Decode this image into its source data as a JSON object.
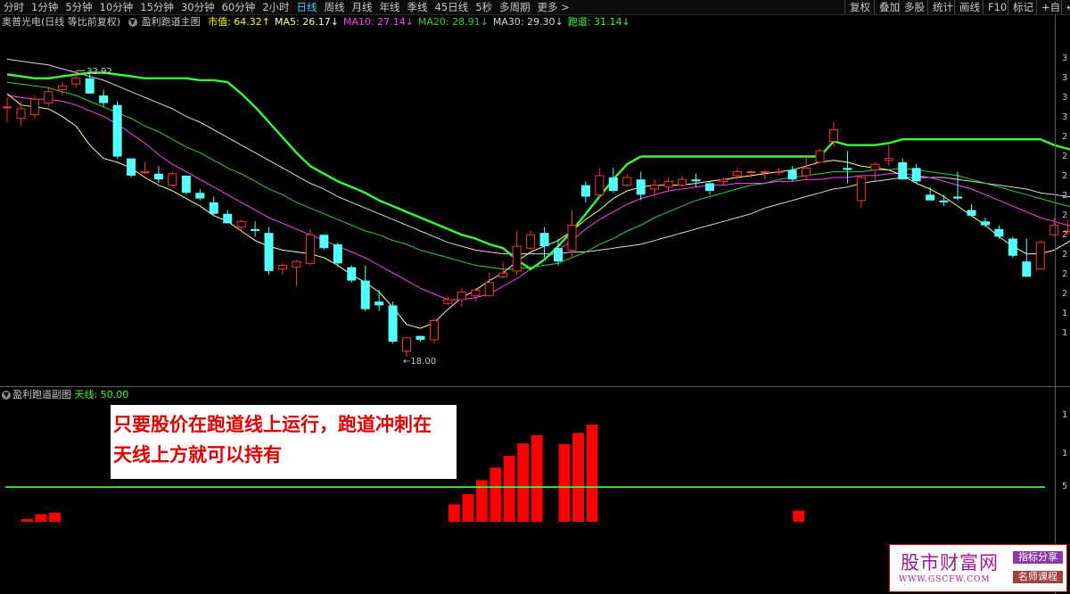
{
  "periods": [
    "分时",
    "1分钟",
    "5分钟",
    "10分钟",
    "15分钟",
    "30分钟",
    "60分钟",
    "2小时",
    "日线",
    "周线",
    "月线",
    "年线",
    "季线",
    "45日线",
    "5秒",
    "多周期",
    "更多 >"
  ],
  "active_period": "日线",
  "toolbar": [
    "复权",
    "叠加",
    "多股",
    "统计",
    "画线",
    "F10",
    "标记",
    "+自选",
    "↩"
  ],
  "main_legend": {
    "stock": "奥普光电(日线 等比前复权)",
    "indicator": "盈利跑道主图",
    "items": [
      {
        "label": "市值: 64.32↑",
        "color": "#ffff00"
      },
      {
        "label": "MA5: 26.17↓",
        "color": "#ffff9a"
      },
      {
        "label": "MA10: 27.14↓",
        "color": "#ff40ff"
      },
      {
        "label": "MA20: 28.91↓",
        "color": "#2ed22e"
      },
      {
        "label": "MA30: 29.30↓",
        "color": "#d8d8d8"
      },
      {
        "label": "跑道: 31.14↓",
        "color": "#33ff33"
      }
    ]
  },
  "sub_legend": {
    "indicator": "盈利跑道副图",
    "value": "天线: 50.00",
    "value_color": "#33ff33"
  },
  "price_labels": {
    "high": "32.92",
    "low": "18.00"
  },
  "y_ticks_main": [
    "3",
    "3",
    "3",
    "3",
    "2",
    "2",
    "2",
    "2",
    "2",
    "2",
    "2",
    "2",
    "2",
    "1",
    "1"
  ],
  "y_ticks_sub": [
    "1",
    "1",
    "5"
  ],
  "annotation": {
    "line1": "只要股价在跑道线上运行，跑道冲刺在",
    "line2": "天线上方就可以持有"
  },
  "watermark": {
    "main": "股市财富网",
    "url": "WWW.GSCFW.COM",
    "tag1": "指标分享",
    "tag2": "名师课程"
  },
  "colors": {
    "up": "#ff3232",
    "down": "#54ffff",
    "runway": "#33ff33",
    "ma5": "#ffff9a",
    "ma10": "#ff40ff",
    "ma20": "#2ed22e",
    "ma30": "#d8d8d8",
    "sub_bar": "#ff0000",
    "antenna": "#33ff33"
  },
  "chart_data": {
    "type": "candlestick",
    "candles": [
      [
        31.0,
        31.5,
        30.2,
        31.0
      ],
      [
        30.4,
        31.3,
        30.0,
        30.9
      ],
      [
        30.6,
        31.6,
        30.4,
        31.4
      ],
      [
        31.2,
        32.0,
        31.0,
        31.8
      ],
      [
        31.9,
        32.3,
        31.6,
        32.1
      ],
      [
        32.2,
        32.9,
        32.0,
        32.5
      ],
      [
        32.5,
        32.8,
        31.7,
        31.7
      ],
      [
        31.6,
        31.9,
        31.0,
        31.2
      ],
      [
        31.1,
        31.3,
        28.3,
        28.4
      ],
      [
        28.3,
        28.3,
        27.3,
        27.4
      ],
      [
        27.6,
        28.1,
        27.5,
        27.6
      ],
      [
        27.5,
        27.9,
        27.0,
        27.2
      ],
      [
        26.9,
        27.6,
        26.8,
        27.5
      ],
      [
        27.4,
        27.4,
        26.4,
        26.5
      ],
      [
        26.5,
        26.7,
        26.1,
        26.2
      ],
      [
        26.0,
        26.3,
        25.3,
        25.4
      ],
      [
        25.4,
        25.6,
        24.9,
        24.9
      ],
      [
        24.7,
        25.1,
        24.5,
        25.0
      ],
      [
        24.6,
        25.0,
        24.2,
        24.5
      ],
      [
        24.4,
        24.7,
        22.2,
        22.4
      ],
      [
        22.5,
        22.8,
        22.2,
        22.7
      ],
      [
        22.6,
        23.0,
        21.6,
        22.9
      ],
      [
        22.8,
        24.6,
        22.7,
        24.3
      ],
      [
        24.3,
        24.3,
        23.5,
        23.6
      ],
      [
        23.8,
        23.9,
        22.6,
        22.8
      ],
      [
        22.6,
        22.7,
        21.8,
        21.9
      ],
      [
        21.9,
        22.7,
        20.3,
        20.4
      ],
      [
        20.8,
        21.4,
        20.3,
        20.6
      ],
      [
        20.6,
        20.8,
        18.6,
        18.7
      ],
      [
        18.2,
        18.9,
        17.9,
        18.9
      ],
      [
        19.0,
        19.0,
        18.7,
        18.8
      ],
      [
        18.8,
        19.9,
        18.6,
        19.8
      ],
      [
        20.7,
        21.1,
        20.6,
        20.9
      ],
      [
        20.9,
        21.5,
        20.5,
        21.3
      ],
      [
        21.1,
        21.5,
        20.8,
        21.4
      ],
      [
        21.1,
        22.3,
        21.1,
        21.8
      ],
      [
        22.1,
        22.9,
        22.0,
        22.3
      ],
      [
        22.4,
        24.5,
        22.2,
        23.7
      ],
      [
        23.6,
        24.5,
        23.5,
        24.3
      ],
      [
        24.4,
        24.7,
        23.1,
        23.7
      ],
      [
        23.6,
        24.1,
        22.7,
        22.9
      ],
      [
        23.5,
        25.6,
        23.1,
        24.8
      ],
      [
        26.9,
        27.1,
        26.0,
        26.3
      ],
      [
        26.4,
        27.8,
        26.2,
        27.4
      ],
      [
        27.3,
        27.8,
        26.5,
        26.6
      ],
      [
        26.9,
        27.5,
        26.8,
        27.3
      ],
      [
        27.2,
        27.6,
        26.1,
        26.4
      ],
      [
        26.7,
        27.2,
        26.3,
        26.9
      ],
      [
        26.8,
        27.3,
        26.6,
        27.1
      ],
      [
        26.9,
        27.4,
        26.8,
        27.2
      ],
      [
        27.2,
        27.5,
        26.8,
        27.1
      ],
      [
        27.0,
        27.1,
        26.4,
        26.6
      ],
      [
        27.1,
        27.3,
        26.9,
        27.2
      ],
      [
        27.4,
        27.8,
        27.2,
        27.6
      ],
      [
        27.6,
        27.7,
        27.3,
        27.6
      ],
      [
        27.6,
        27.7,
        27.2,
        27.6
      ],
      [
        27.6,
        27.8,
        27.4,
        27.6
      ],
      [
        27.7,
        27.9,
        27.1,
        27.2
      ],
      [
        27.4,
        28.4,
        27.2,
        27.8
      ],
      [
        28.1,
        28.8,
        28.1,
        28.7
      ],
      [
        29.2,
        30.2,
        28.9,
        29.8
      ],
      [
        27.8,
        28.7,
        27.0,
        27.7
      ],
      [
        26.1,
        27.4,
        25.7,
        27.3
      ],
      [
        27.7,
        28.1,
        27.1,
        28.0
      ],
      [
        28.2,
        29.0,
        27.9,
        28.3
      ],
      [
        28.1,
        28.3,
        27.2,
        27.2
      ],
      [
        27.8,
        28.0,
        27.0,
        27.1
      ],
      [
        26.4,
        26.8,
        26.1,
        26.1
      ],
      [
        26.1,
        26.4,
        25.8,
        26.0
      ],
      [
        26.3,
        27.6,
        26.1,
        26.2
      ],
      [
        25.6,
        25.9,
        25.3,
        25.3
      ],
      [
        25.0,
        25.2,
        24.7,
        24.8
      ],
      [
        24.6,
        24.8,
        24.1,
        24.2
      ],
      [
        24.1,
        24.2,
        23.1,
        23.2
      ],
      [
        22.9,
        24.1,
        22.1,
        22.1
      ],
      [
        22.5,
        24.0,
        22.5,
        23.9
      ],
      [
        24.3,
        25.2,
        24.2,
        24.8
      ],
      [
        24.5,
        25.1,
        24.3,
        24.5
      ],
      [
        24.3,
        25.1,
        24.3,
        24.9
      ]
    ],
    "ma5": [
      31.7,
      31.1,
      31.0,
      30.9,
      30.5,
      30.0,
      29.0,
      28.3,
      28.1,
      27.8,
      27.3,
      26.9,
      26.6,
      26.2,
      25.8,
      25.3,
      25.0,
      24.5,
      24.0,
      23.7,
      23.5,
      23.4,
      23.3,
      23.1,
      22.7,
      22.2,
      21.8,
      21.3,
      20.5,
      19.6,
      19.4,
      19.7,
      20.4,
      21.0,
      21.4,
      21.9,
      22.3,
      22.9,
      23.4,
      23.7,
      24.0,
      24.5,
      25.1,
      25.6,
      26.2,
      26.6,
      26.8,
      26.9,
      26.9,
      26.9,
      27.0,
      27.1,
      27.2,
      27.3,
      27.4,
      27.5,
      27.6,
      27.7,
      27.9,
      28.1,
      28.2,
      28.1,
      27.9,
      27.8,
      27.7,
      27.4,
      27.0,
      26.7,
      26.3,
      25.8,
      25.3,
      24.8,
      24.2,
      23.7,
      23.3,
      23.3,
      23.5,
      23.9,
      24.4
    ],
    "ma10": [
      31.6,
      31.5,
      31.4,
      31.4,
      31.3,
      31.1,
      30.8,
      30.5,
      30.1,
      29.6,
      29.1,
      28.5,
      28.0,
      27.6,
      27.2,
      26.8,
      26.4,
      26.0,
      25.6,
      25.2,
      24.9,
      24.6,
      24.3,
      24.0,
      23.7,
      23.4,
      23.1,
      22.7,
      22.3,
      21.9,
      21.5,
      21.2,
      20.9,
      20.9,
      21.0,
      21.2,
      21.6,
      22.0,
      22.5,
      23.0,
      23.5,
      24.0,
      24.6,
      25.1,
      25.5,
      25.9,
      26.2,
      26.4,
      26.6,
      26.7,
      26.8,
      26.9,
      26.9,
      27.0,
      27.0,
      27.0,
      27.1,
      27.1,
      27.2,
      27.2,
      27.3,
      27.3,
      27.4,
      27.4,
      27.5,
      27.5,
      27.4,
      27.3,
      27.1,
      26.9,
      26.7,
      26.4,
      26.1,
      25.8,
      25.5,
      25.2,
      25.0,
      24.8,
      24.6
    ],
    "ma20": [
      32.3,
      32.2,
      32.1,
      32.0,
      31.8,
      31.6,
      31.3,
      31.0,
      30.7,
      30.4,
      30.0,
      29.7,
      29.3,
      28.9,
      28.6,
      28.2,
      27.8,
      27.5,
      27.1,
      26.7,
      26.4,
      26.0,
      25.7,
      25.4,
      25.1,
      24.8,
      24.5,
      24.3,
      24.0,
      23.8,
      23.5,
      23.3,
      23.1,
      22.9,
      22.7,
      22.6,
      22.5,
      22.5,
      22.6,
      22.7,
      22.8,
      23.1,
      23.4,
      23.8,
      24.1,
      24.5,
      24.8,
      25.2,
      25.5,
      25.8,
      26.1,
      26.3,
      26.5,
      26.7,
      26.9,
      27.0,
      27.2,
      27.3,
      27.4,
      27.5,
      27.6,
      27.6,
      27.6,
      27.7,
      27.7,
      27.8,
      27.7,
      27.6,
      27.5,
      27.4,
      27.2,
      27.0,
      26.8,
      26.6,
      26.4,
      26.2,
      26.0,
      25.8,
      25.6
    ],
    "ma30": [
      33.5,
      33.4,
      33.3,
      33.2,
      33.0,
      32.8,
      32.6,
      32.4,
      32.1,
      31.8,
      31.5,
      31.2,
      30.9,
      30.5,
      30.2,
      29.8,
      29.4,
      29.0,
      28.6,
      28.2,
      27.8,
      27.4,
      27.0,
      26.7,
      26.3,
      26.0,
      25.7,
      25.4,
      25.1,
      24.8,
      24.5,
      24.2,
      23.9,
      23.7,
      23.5,
      23.4,
      23.3,
      23.3,
      23.3,
      23.3,
      23.3,
      23.4,
      23.4,
      23.5,
      23.6,
      23.7,
      23.8,
      24.0,
      24.2,
      24.4,
      24.6,
      24.8,
      25.0,
      25.2,
      25.4,
      25.7,
      25.9,
      26.1,
      26.3,
      26.5,
      26.7,
      26.8,
      27.0,
      27.1,
      27.2,
      27.3,
      27.3,
      27.3,
      27.3,
      27.2,
      27.1,
      27.0,
      26.9,
      26.8,
      26.7,
      26.5,
      26.4,
      26.3,
      26.2
    ],
    "runway": [
      32.7,
      32.6,
      32.5,
      32.5,
      32.6,
      32.7,
      32.8,
      32.8,
      32.7,
      32.6,
      32.5,
      32.5,
      32.5,
      32.5,
      32.4,
      32.4,
      32.3,
      31.7,
      31.0,
      30.2,
      29.4,
      28.6,
      27.9,
      27.5,
      27.1,
      26.8,
      26.5,
      26.1,
      25.8,
      25.5,
      25.2,
      24.9,
      24.6,
      24.3,
      24.1,
      23.8,
      23.6,
      23.0,
      22.5,
      23.0,
      23.7,
      24.5,
      25.4,
      26.3,
      27.2,
      28.0,
      28.4,
      28.4,
      28.4,
      28.4,
      28.4,
      28.4,
      28.4,
      28.4,
      28.4,
      28.4,
      28.4,
      28.4,
      28.4,
      28.4,
      29.2,
      29.0,
      29.0,
      29.0,
      29.1,
      29.3,
      29.3,
      29.3,
      29.3,
      29.3,
      29.3,
      29.3,
      29.3,
      29.3,
      29.3,
      29.3,
      29.0,
      28.8,
      28.6
    ],
    "ylim": [
      16.6,
      35.2
    ],
    "sub_bars": [
      [
        1,
        4
      ],
      [
        2,
        11
      ],
      [
        3,
        13
      ],
      [
        32,
        25
      ],
      [
        33,
        40
      ],
      [
        34,
        60
      ],
      [
        35,
        78
      ],
      [
        36,
        95
      ],
      [
        37,
        113
      ],
      [
        38,
        125
      ],
      [
        40,
        112
      ],
      [
        41,
        128
      ],
      [
        42,
        140
      ],
      [
        57,
        16
      ]
    ],
    "antenna": 50,
    "sub_ylim": [
      0,
      180
    ]
  }
}
